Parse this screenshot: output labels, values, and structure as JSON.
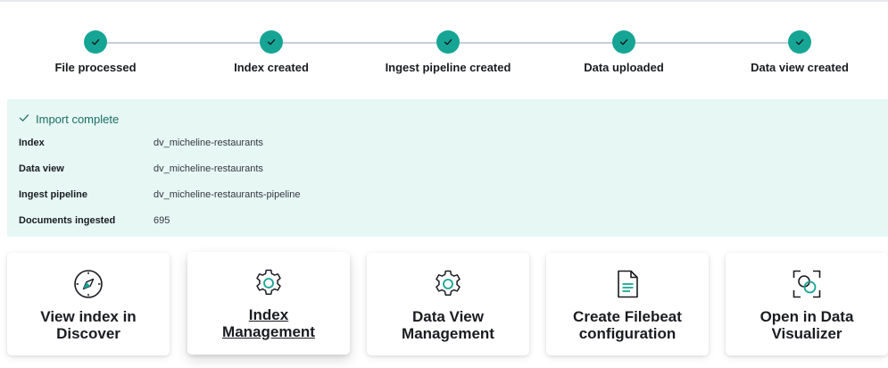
{
  "steps": [
    {
      "label": "File processed",
      "icon": "check-icon"
    },
    {
      "label": "Index created",
      "icon": "check-icon"
    },
    {
      "label": "Ingest pipeline created",
      "icon": "check-icon"
    },
    {
      "label": "Data uploaded",
      "icon": "check-icon"
    },
    {
      "label": "Data view created",
      "icon": "check-icon"
    }
  ],
  "callout": {
    "title": "Import complete",
    "details": [
      {
        "label": "Index",
        "value": "dv_micheline-restaurants"
      },
      {
        "label": "Data view",
        "value": "dv_micheline-restaurants"
      },
      {
        "label": "Ingest pipeline",
        "value": "dv_micheline-restaurants-pipeline"
      },
      {
        "label": "Documents ingested",
        "value": "695"
      }
    ]
  },
  "cards": [
    {
      "line1": "View index in",
      "line2": "Discover",
      "icon": "compass-icon"
    },
    {
      "line1": "Index",
      "line2": "Management",
      "icon": "gear-icon"
    },
    {
      "line1": "Data View",
      "line2": "Management",
      "icon": "gear-icon"
    },
    {
      "line1": "Create Filebeat",
      "line2": "configuration",
      "icon": "document-icon"
    },
    {
      "line1": "Open in Data",
      "line2": "Visualizer",
      "icon": "visualizer-icon"
    }
  ],
  "colors": {
    "step_complete": "#16a594",
    "callout_bg": "#e6f7f4",
    "callout_title": "#1b6e63"
  }
}
